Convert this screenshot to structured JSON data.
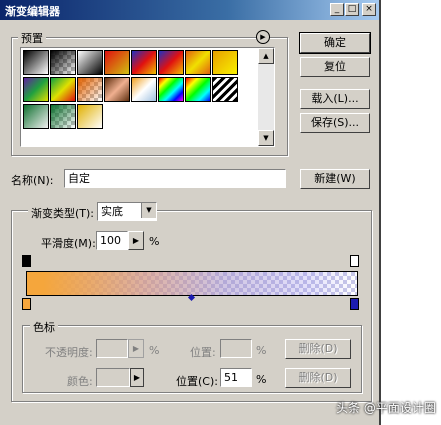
{
  "window": {
    "title": "渐变编辑器"
  },
  "titlebar_buttons": {
    "minimize": "_",
    "maximize": "□",
    "close": "×"
  },
  "presets": {
    "label": "预置"
  },
  "buttons": {
    "ok": "确定",
    "reset": "复位",
    "load": "载入(L)...",
    "save": "保存(S)...",
    "new": "新建(W)"
  },
  "name": {
    "label": "名称(N):",
    "value": "自定"
  },
  "gradient_type": {
    "label": "渐变类型(T):",
    "value": "实底"
  },
  "smoothness": {
    "label": "平滑度(M):",
    "value": "100",
    "unit": "%"
  },
  "stops": {
    "group_label": "色标",
    "opacity_label": "不透明度:",
    "opacity_unit": "%",
    "opacity_location_label": "位置:",
    "opacity_location_unit": "%",
    "delete_label": "删除(D)",
    "color_label": "颜色:",
    "color_location_label": "位置(C):",
    "color_location_value": "51",
    "color_location_unit": "%",
    "delete_label_2": "删除(D)"
  },
  "colors": {
    "start": "#f5a63c",
    "end": "#1c1cb0",
    "accent": "#0a246a"
  },
  "watermark": "头条 @平面设计圈"
}
